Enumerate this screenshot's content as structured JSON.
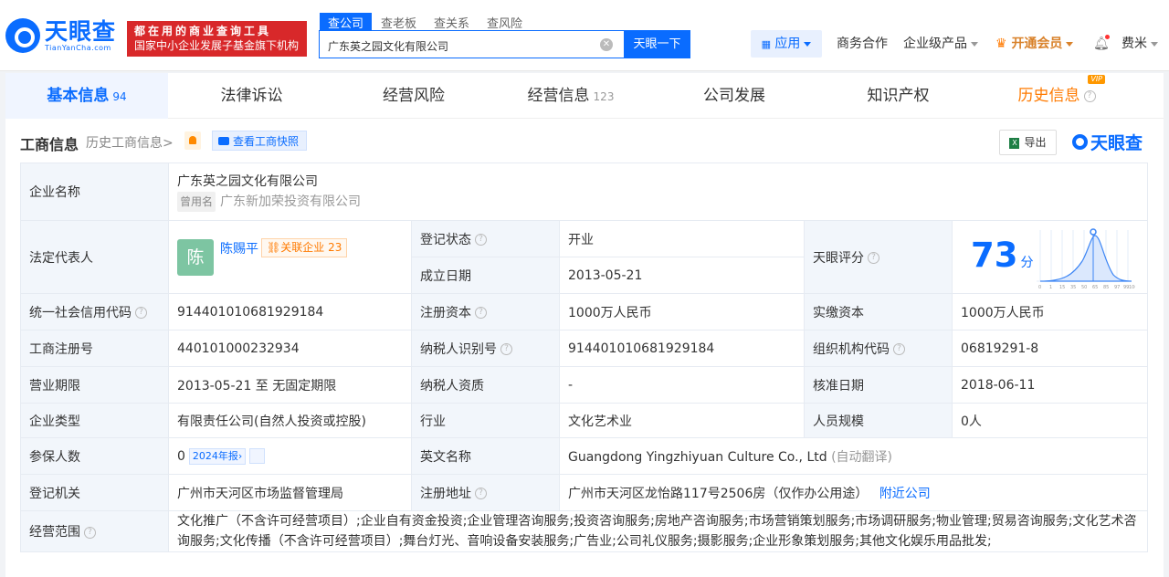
{
  "header": {
    "logo_cn": "天眼查",
    "logo_en": "TianYanCha.com",
    "slogan_line1": "都在用的商业查询工具",
    "slogan_line2": "国家中小企业发展子基金旗下机构",
    "search_tabs": [
      "查公司",
      "查老板",
      "查关系",
      "查风险"
    ],
    "search_value": "广东英之园文化有限公司",
    "search_button": "天眼一下",
    "nav": {
      "app": "应用",
      "business": "商务合作",
      "enterprise": "企业级产品",
      "vip": "开通会员",
      "user": "费米"
    }
  },
  "tabs": [
    {
      "label": "基本信息",
      "count": "94"
    },
    {
      "label": "法律诉讼",
      "count": ""
    },
    {
      "label": "经营风险",
      "count": ""
    },
    {
      "label": "经营信息",
      "count": "123"
    },
    {
      "label": "公司发展",
      "count": ""
    },
    {
      "label": "知识产权",
      "count": ""
    },
    {
      "label": "历史信息",
      "count": "",
      "badge": "VIP"
    }
  ],
  "section": {
    "title": "工商信息",
    "history_link": "历史工商信息>",
    "snapshot_button": "查看工商快照",
    "export_button": "导出",
    "brand": "天眼查"
  },
  "info": {
    "company_name_label": "企业名称",
    "company_name": "广东英之园文化有限公司",
    "former_name_tag": "曾用名",
    "former_name": "广东新加荣投资有限公司",
    "legal_rep_label": "法定代表人",
    "legal_rep_avatar": "陈",
    "legal_rep_name": "陈赐平",
    "related_label": "关联企业",
    "related_count": "23",
    "reg_status_label": "登记状态",
    "reg_status": "开业",
    "est_date_label": "成立日期",
    "est_date": "2013-05-21",
    "score_label": "天眼评分",
    "score": "73",
    "score_unit": "分",
    "score_axis": [
      "0",
      "1",
      "15",
      "35",
      "50",
      "65",
      "85",
      "97",
      "99",
      "100"
    ],
    "credit_code_label": "统一社会信用代码",
    "credit_code": "914401010681929184",
    "reg_capital_label": "注册资本",
    "reg_capital": "1000万人民币",
    "paid_capital_label": "实缴资本",
    "paid_capital": "1000万人民币",
    "reg_no_label": "工商注册号",
    "reg_no": "440101000232934",
    "taxpayer_id_label": "纳税人识别号",
    "taxpayer_id": "914401010681929184",
    "org_code_label": "组织机构代码",
    "org_code": "06819291-8",
    "term_label": "营业期限",
    "term": "2013-05-21 至 无固定期限",
    "taxpayer_qual_label": "纳税人资质",
    "taxpayer_qual": "-",
    "approve_date_label": "核准日期",
    "approve_date": "2018-06-11",
    "type_label": "企业类型",
    "type": "有限责任公司(自然人投资或控股)",
    "industry_label": "行业",
    "industry": "文化艺术业",
    "staff_label": "人员规模",
    "staff": "0人",
    "insured_label": "参保人数",
    "insured": "0",
    "report_tag": "2024年报›",
    "english_label": "英文名称",
    "english_name": "Guangdong Yingzhiyuan Culture Co., Ltd",
    "auto_translate": "(自动翻译)",
    "authority_label": "登记机关",
    "authority": "广州市天河区市场监督管理局",
    "address_label": "注册地址",
    "address": "广州市天河区龙怡路117号2506房（仅作办公用途）",
    "nearby": "附近公司",
    "scope_label": "经营范围",
    "scope": "文化推广（不含许可经营项目）;企业自有资金投资;企业管理咨询服务;投资咨询服务;房地产咨询服务;市场营销策划服务;市场调研服务;物业管理;贸易咨询服务;文化艺术咨询服务;文化传播（不含许可经营项目）;舞台灯光、音响设备安装服务;广告业;公司礼仪服务;摄影服务;企业形象策划服务;其他文化娱乐用品批发;"
  }
}
